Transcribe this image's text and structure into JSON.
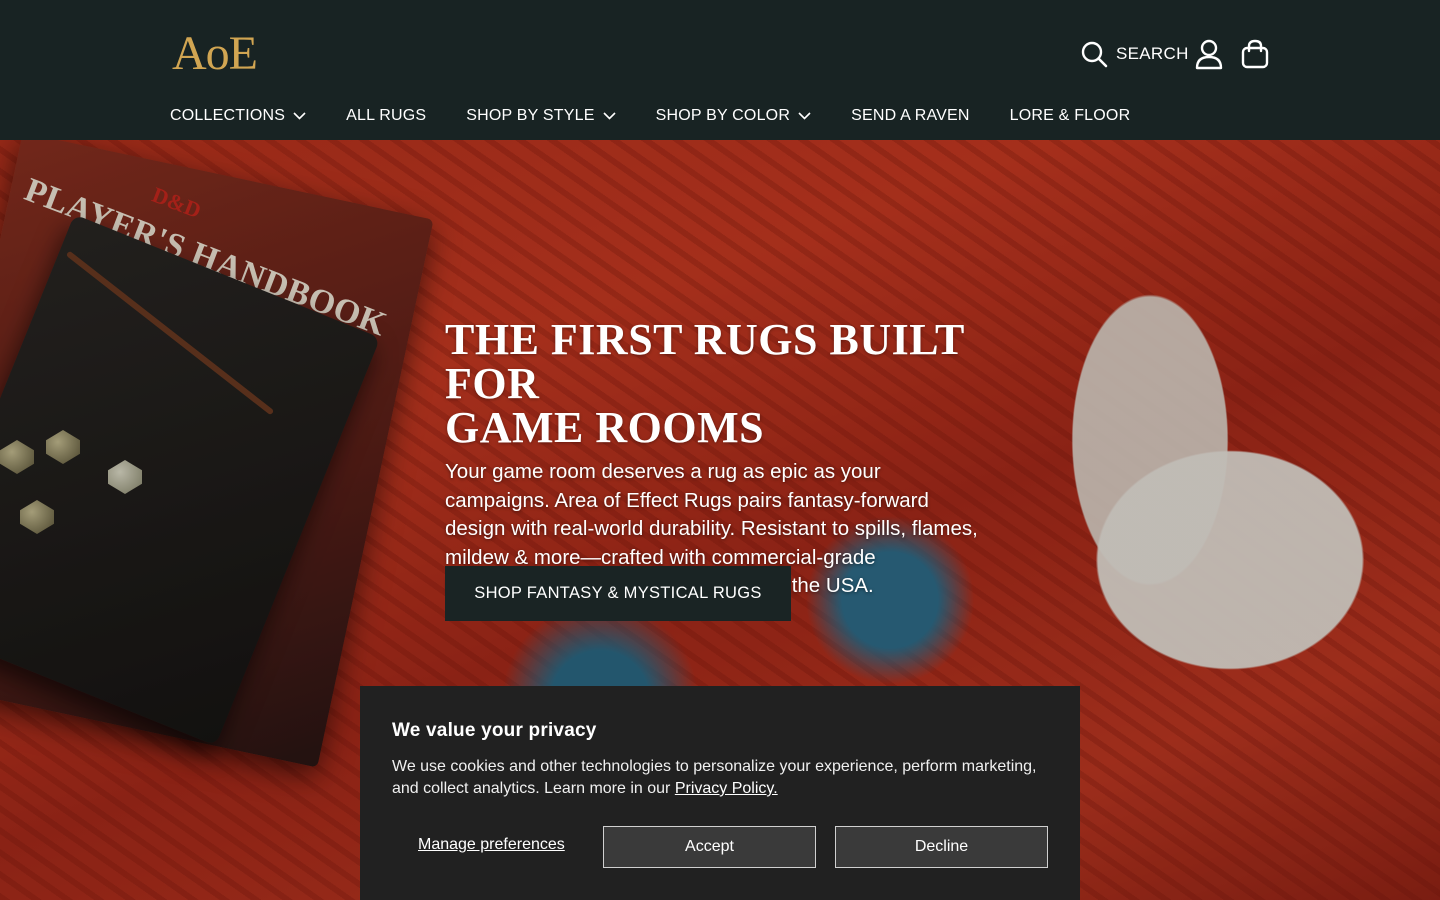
{
  "header": {
    "logo": "AoE",
    "search_label": "SEARCH",
    "nav": [
      {
        "label": "COLLECTIONS",
        "has_dropdown": true
      },
      {
        "label": "ALL RUGS",
        "has_dropdown": false
      },
      {
        "label": "SHOP BY STYLE",
        "has_dropdown": true
      },
      {
        "label": "SHOP BY COLOR",
        "has_dropdown": true
      },
      {
        "label": "SEND A RAVEN",
        "has_dropdown": false
      },
      {
        "label": "LORE & FLOOR",
        "has_dropdown": false
      }
    ],
    "icons": [
      "search-icon",
      "account-icon",
      "cart-icon"
    ]
  },
  "hero": {
    "book_title": "PLAYER'S HANDBOOK",
    "book_badge": "D&D",
    "title_line1": "THE FIRST RUGS BUILT FOR",
    "title_line2": "GAME ROOMS",
    "body": "Your game room deserves a rug as epic as your campaigns. Area of Effect Rugs pairs fantasy-forward design with real-world durability. Resistant to spills, flames, mildew & more—crafted with commercial-grade EnduraStran© nylon, made entirely in the USA.",
    "cta_label": "SHOP FANTASY & MYSTICAL RUGS"
  },
  "cookie": {
    "title": "We value your privacy",
    "text": "We use cookies and other technologies to personalize your experience, perform marketing, and collect analytics. Learn more in our",
    "link_label": "Privacy Policy.",
    "manage_label": "Manage preferences",
    "accept_label": "Accept",
    "decline_label": "Decline"
  },
  "colors": {
    "header_bg": "#182323",
    "logo_gold": "#d1a552",
    "cta_bg": "#1a2424",
    "cookie_bg": "#212121"
  }
}
